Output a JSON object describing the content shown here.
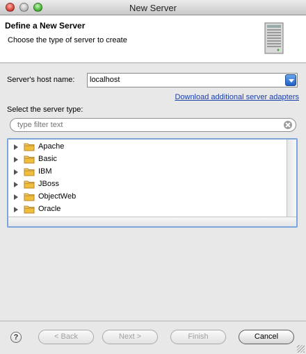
{
  "window": {
    "title": "New Server"
  },
  "header": {
    "title": "Define a New Server",
    "description": "Choose the type of server to create",
    "icon": "server-tower-icon"
  },
  "host": {
    "label": "Server's host name:",
    "value": "localhost"
  },
  "links": {
    "download_adapters": "Download additional server adapters"
  },
  "server_type": {
    "label": "Select the server type:",
    "filter_placeholder": "type filter text",
    "items": [
      {
        "label": "Apache"
      },
      {
        "label": "Basic"
      },
      {
        "label": "IBM"
      },
      {
        "label": "JBoss"
      },
      {
        "label": "ObjectWeb"
      },
      {
        "label": "Oracle"
      }
    ]
  },
  "buttons": {
    "help": "?",
    "back": "< Back",
    "next": "Next >",
    "finish": "Finish",
    "cancel": "Cancel"
  },
  "colors": {
    "link": "#1a3fa8",
    "focus_ring": "#7aa6dc",
    "combo_button": "#1f5fc6",
    "folder": "#e9b22f"
  }
}
